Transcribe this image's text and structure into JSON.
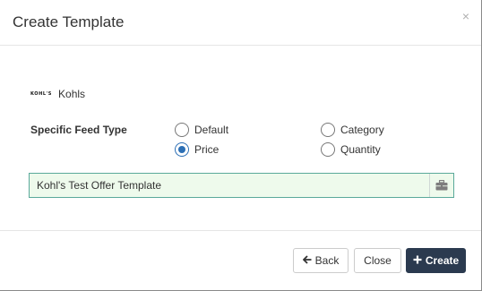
{
  "dialog": {
    "title": "Create Template",
    "close_glyph": "×"
  },
  "brand": {
    "logo_text": "KOHL'S",
    "name": "Kohls"
  },
  "feed_type": {
    "label": "Specific Feed Type",
    "selected": "Price",
    "options": [
      {
        "label": "Default",
        "checked": false
      },
      {
        "label": "Category",
        "checked": false
      },
      {
        "label": "Price",
        "checked": true
      },
      {
        "label": "Quantity",
        "checked": false
      }
    ]
  },
  "template_name": {
    "value": "Kohl's Test Offer Template",
    "addon_icon": "briefcase-icon"
  },
  "footer": {
    "back_label": "Back",
    "back_icon": "arrow-left-icon",
    "close_label": "Close",
    "create_label": "Create",
    "create_icon": "plus-icon"
  },
  "colors": {
    "primary_button": "#2b3a4f",
    "radio_checked": "#2c6fb5",
    "input_border": "#5aa99a",
    "input_background": "#eefaec"
  }
}
